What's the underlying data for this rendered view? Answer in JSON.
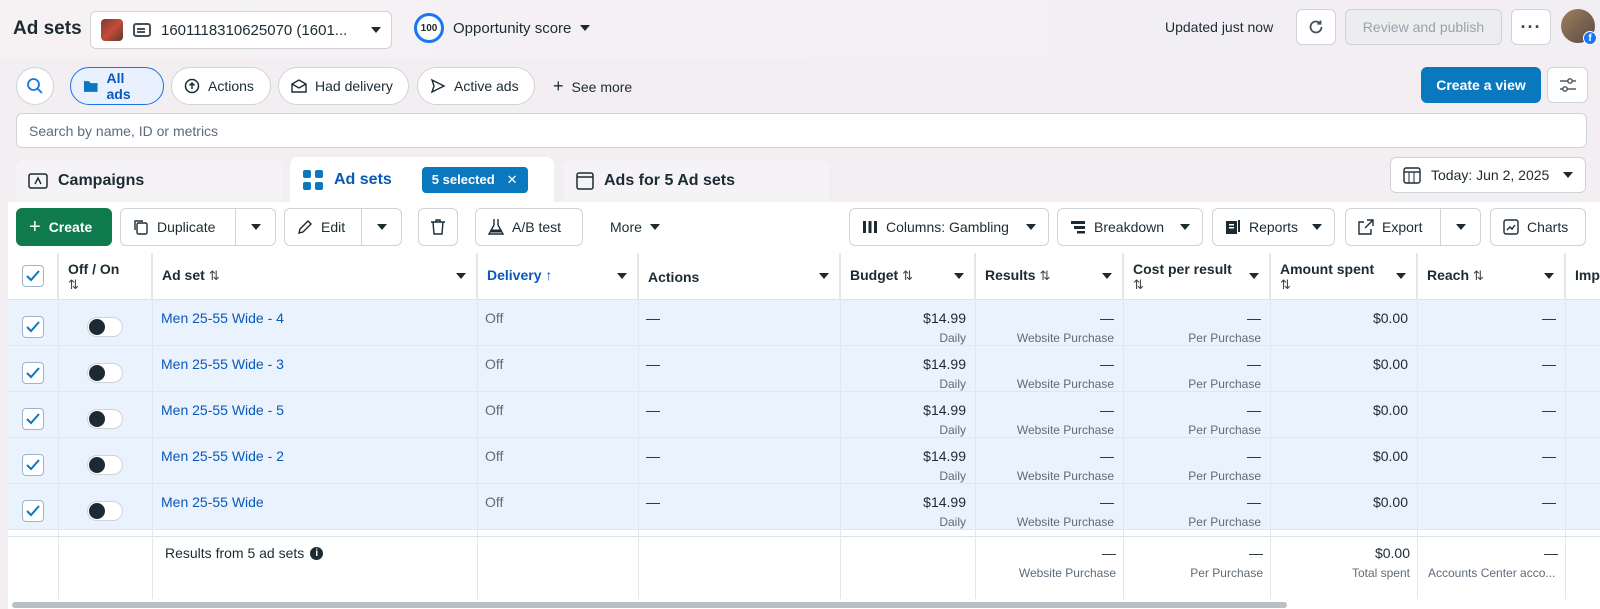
{
  "header": {
    "title": "Ad sets",
    "account": "1601118310625070 (1601...",
    "opportunity_score": "100",
    "opportunity_label": "Opportunity score",
    "updated": "Updated just now",
    "review_publish": "Review and publish"
  },
  "filters": {
    "pills": [
      "All ads",
      "Actions",
      "Had delivery",
      "Active ads"
    ],
    "see_more": "See more",
    "create_view": "Create a view",
    "search_placeholder": "Search by name, ID or metrics"
  },
  "tabs": {
    "campaigns": "Campaigns",
    "adsets": "Ad sets",
    "selected_chip": "5 selected",
    "ads": "Ads for 5 Ad sets"
  },
  "date_range": "Today: Jun 2, 2025",
  "toolbar": {
    "create": "Create",
    "duplicate": "Duplicate",
    "edit": "Edit",
    "ab_test": "A/B test",
    "more": "More",
    "columns": "Columns: Gambling",
    "breakdown": "Breakdown",
    "reports": "Reports",
    "export": "Export",
    "charts": "Charts"
  },
  "table": {
    "headers": {
      "offon": "Off / On",
      "adset": "Ad set",
      "delivery": "Delivery",
      "actions": "Actions",
      "budget": "Budget",
      "results": "Results",
      "cpr": "Cost per result",
      "spent": "Amount spent",
      "reach": "Reach",
      "imp": "Imp"
    },
    "rows": [
      {
        "name": "Men 25-55 Wide - 4",
        "delivery": "Off",
        "actions": "—",
        "budget": "$14.99",
        "budget_sub": "Daily",
        "results": "—",
        "results_sub": "Website Purchase",
        "cpr": "—",
        "cpr_sub": "Per Purchase",
        "spent": "$0.00",
        "reach": "—"
      },
      {
        "name": "Men 25-55 Wide - 3",
        "delivery": "Off",
        "actions": "—",
        "budget": "$14.99",
        "budget_sub": "Daily",
        "results": "—",
        "results_sub": "Website Purchase",
        "cpr": "—",
        "cpr_sub": "Per Purchase",
        "spent": "$0.00",
        "reach": "—"
      },
      {
        "name": "Men 25-55 Wide - 5",
        "delivery": "Off",
        "actions": "—",
        "budget": "$14.99",
        "budget_sub": "Daily",
        "results": "—",
        "results_sub": "Website Purchase",
        "cpr": "—",
        "cpr_sub": "Per Purchase",
        "spent": "$0.00",
        "reach": "—"
      },
      {
        "name": "Men 25-55 Wide - 2",
        "delivery": "Off",
        "actions": "—",
        "budget": "$14.99",
        "budget_sub": "Daily",
        "results": "—",
        "results_sub": "Website Purchase",
        "cpr": "—",
        "cpr_sub": "Per Purchase",
        "spent": "$0.00",
        "reach": "—"
      },
      {
        "name": "Men 25-55 Wide",
        "delivery": "Off",
        "actions": "—",
        "budget": "$14.99",
        "budget_sub": "Daily",
        "results": "—",
        "results_sub": "Website Purchase",
        "cpr": "—",
        "cpr_sub": "Per Purchase",
        "spent": "$0.00",
        "reach": "—"
      }
    ],
    "footer": {
      "label": "Results from 5 ad sets",
      "results": "—",
      "results_sub": "Website Purchase",
      "cpr": "—",
      "cpr_sub": "Per Purchase",
      "spent": "$0.00",
      "spent_sub": "Total spent",
      "reach": "—",
      "reach_sub": "Accounts Center acco..."
    }
  }
}
